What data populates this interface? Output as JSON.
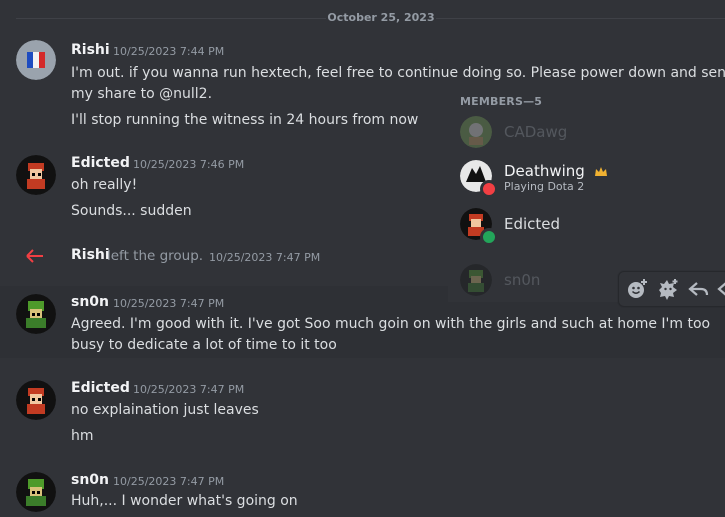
{
  "date_divider": "October 25, 2023",
  "messages": [
    {
      "author": "Rishi",
      "timestamp": "10/25/2023 7:44 PM",
      "lines": [
        "I'm out. if you wanna run hextech, feel free to continue doing so. Please power down and send",
        "my share to @null2.",
        "I'll stop running the witness in 24 hours from now"
      ]
    },
    {
      "author": "Edicted",
      "timestamp": "10/25/2023 7:46 PM",
      "lines": [
        "oh really!",
        "Sounds... sudden"
      ]
    },
    {
      "author": "sn0n",
      "timestamp": "10/25/2023 7:47 PM",
      "lines": [
        "Agreed. I'm good with it. I've got Soo much goin on with the girls and such at home I'm too",
        "busy to dedicate a lot of time to it too"
      ]
    },
    {
      "author": "Edicted",
      "timestamp": "10/25/2023 7:47 PM",
      "lines": [
        "no explaination just leaves",
        "hm"
      ]
    },
    {
      "author": "sn0n",
      "timestamp": "10/25/2023 7:47 PM",
      "lines": [
        "Huh,... I wonder what's going on"
      ]
    }
  ],
  "system_message": {
    "author": "Rishi",
    "text": "left the group.",
    "timestamp": "10/25/2023 7:47 PM",
    "icon": "leave-arrow-icon"
  },
  "members_panel": {
    "header": "MEMBERS—5",
    "members": [
      {
        "name": "CADawg",
        "status": "offline"
      },
      {
        "name": "Deathwing",
        "activity": "Playing Dota 2",
        "status": "dnd",
        "badge": "crown-icon"
      },
      {
        "name": "Edicted",
        "status": "online"
      },
      {
        "name": "sn0n",
        "status": "offline"
      }
    ]
  },
  "message_toolbar": {
    "icons": [
      "add-reaction-icon",
      "super-reaction-icon",
      "reply-icon",
      "more-icon"
    ]
  },
  "colors": {
    "background": "#313338",
    "online": "#23a55a",
    "dnd": "#f23f43",
    "leave_arrow": "#f23f43",
    "crown": "#f0b232"
  }
}
